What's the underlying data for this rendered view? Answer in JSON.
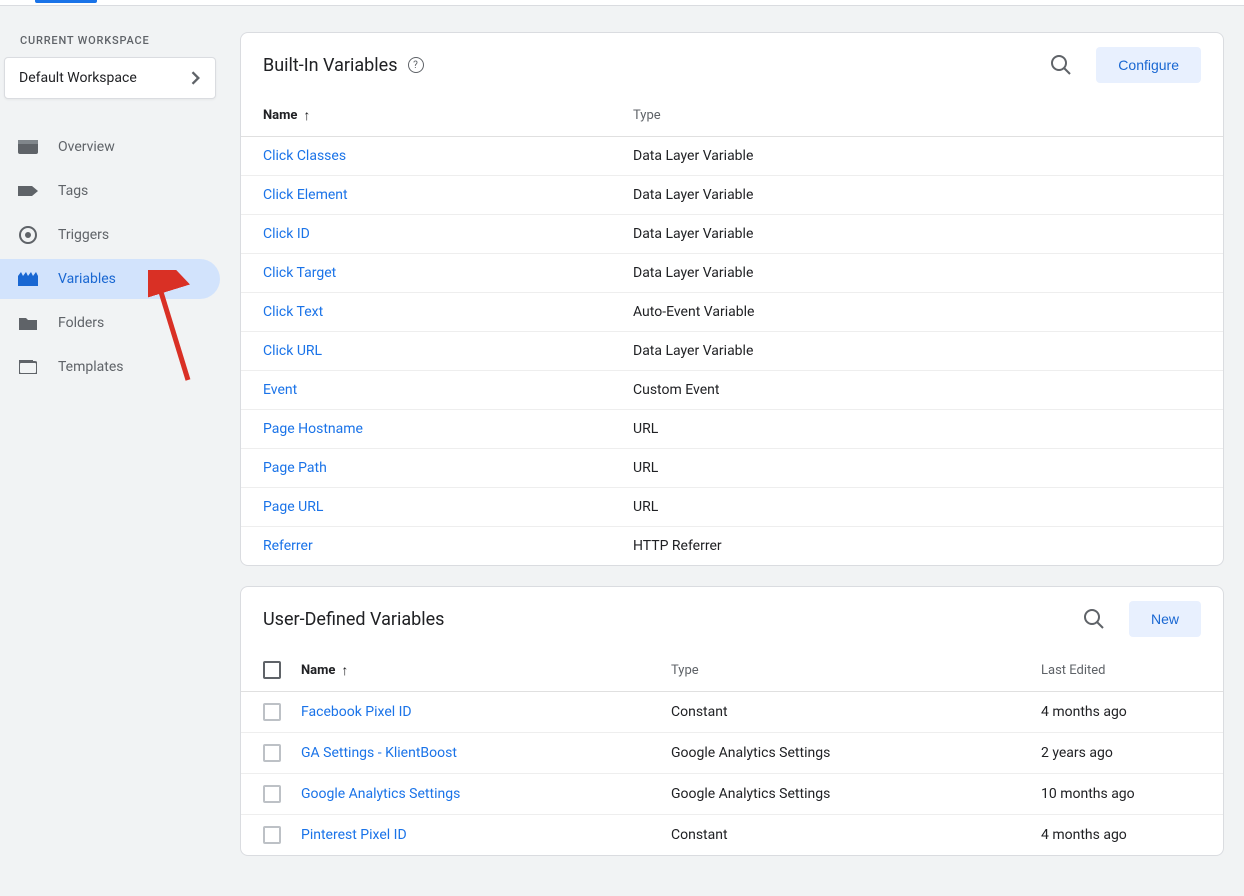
{
  "workspace": {
    "label": "CURRENT WORKSPACE",
    "name": "Default Workspace"
  },
  "nav": {
    "items": [
      {
        "label": "Overview",
        "icon": "overview"
      },
      {
        "label": "Tags",
        "icon": "tag"
      },
      {
        "label": "Triggers",
        "icon": "trigger"
      },
      {
        "label": "Variables",
        "icon": "variable"
      },
      {
        "label": "Folders",
        "icon": "folder"
      },
      {
        "label": "Templates",
        "icon": "template"
      }
    ],
    "active_index": 3
  },
  "builtin": {
    "title": "Built-In Variables",
    "configure_label": "Configure",
    "columns": {
      "name": "Name",
      "type": "Type"
    },
    "rows": [
      {
        "name": "Click Classes",
        "type": "Data Layer Variable"
      },
      {
        "name": "Click Element",
        "type": "Data Layer Variable"
      },
      {
        "name": "Click ID",
        "type": "Data Layer Variable"
      },
      {
        "name": "Click Target",
        "type": "Data Layer Variable"
      },
      {
        "name": "Click Text",
        "type": "Auto-Event Variable"
      },
      {
        "name": "Click URL",
        "type": "Data Layer Variable"
      },
      {
        "name": "Event",
        "type": "Custom Event"
      },
      {
        "name": "Page Hostname",
        "type": "URL"
      },
      {
        "name": "Page Path",
        "type": "URL"
      },
      {
        "name": "Page URL",
        "type": "URL"
      },
      {
        "name": "Referrer",
        "type": "HTTP Referrer"
      }
    ]
  },
  "userdef": {
    "title": "User-Defined Variables",
    "new_label": "New",
    "columns": {
      "name": "Name",
      "type": "Type",
      "edited": "Last Edited"
    },
    "rows": [
      {
        "name": "Facebook Pixel ID",
        "type": "Constant",
        "edited": "4 months ago"
      },
      {
        "name": "GA Settings - KlientBoost",
        "type": "Google Analytics Settings",
        "edited": "2 years ago"
      },
      {
        "name": "Google Analytics Settings",
        "type": "Google Analytics Settings",
        "edited": "10 months ago"
      },
      {
        "name": "Pinterest Pixel ID",
        "type": "Constant",
        "edited": "4 months ago"
      }
    ]
  }
}
